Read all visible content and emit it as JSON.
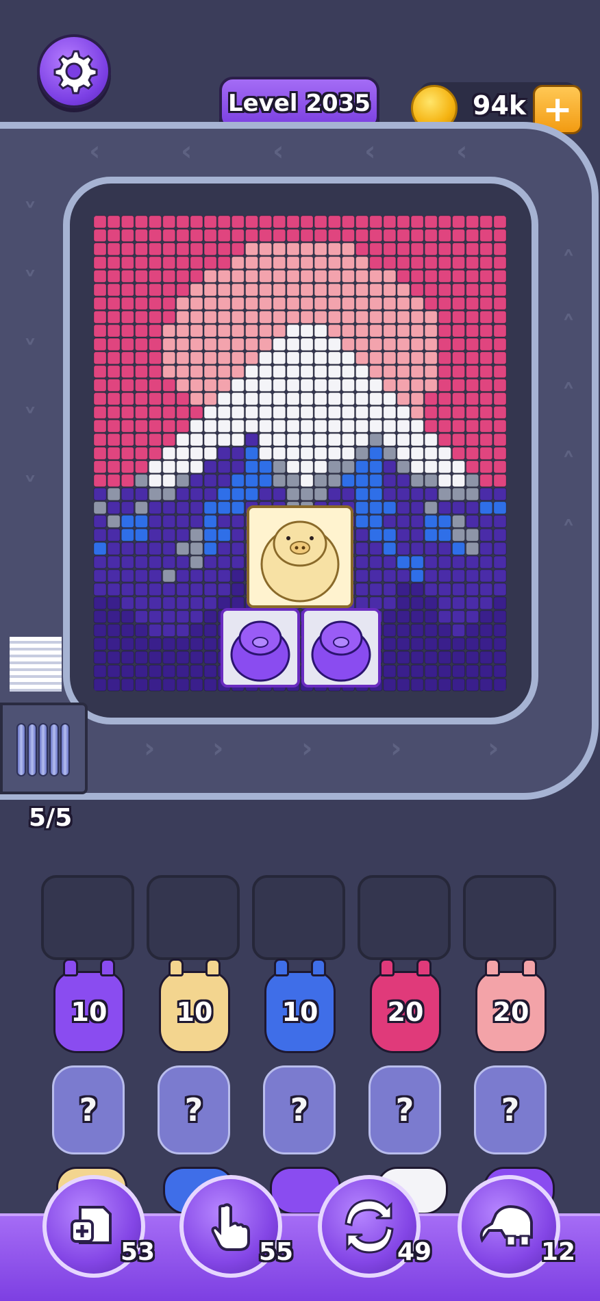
{
  "header": {
    "level_label": "Level 2035",
    "coins": "94k",
    "add_coins": "+"
  },
  "conveyor": {
    "capacity": "5/5"
  },
  "shooters": [
    {
      "count": "10",
      "color": "#8a4cf0"
    },
    {
      "count": "10",
      "color": "#f3d58f"
    },
    {
      "count": "10",
      "color": "#3f6ee8"
    },
    {
      "count": "20",
      "color": "#e03a7a"
    },
    {
      "count": "20",
      "color": "#f3a3a8"
    }
  ],
  "mystery": [
    "?",
    "?",
    "?",
    "?",
    "?"
  ],
  "boosters": [
    {
      "icon": "add-slot-icon",
      "count": "53"
    },
    {
      "icon": "hand-pointer-icon",
      "count": "55"
    },
    {
      "icon": "shuffle-icon",
      "count": "49"
    },
    {
      "icon": "vacuum-icon",
      "count": "12"
    }
  ],
  "palette": {
    "pink": "#e0457f",
    "light_pink": "#f3a3ad",
    "white": "#f4f4f8",
    "gray": "#8e95a8",
    "blue": "#2f6fe8",
    "indigo": "#4a2ca8",
    "deep_purple": "#3a1f8c"
  }
}
